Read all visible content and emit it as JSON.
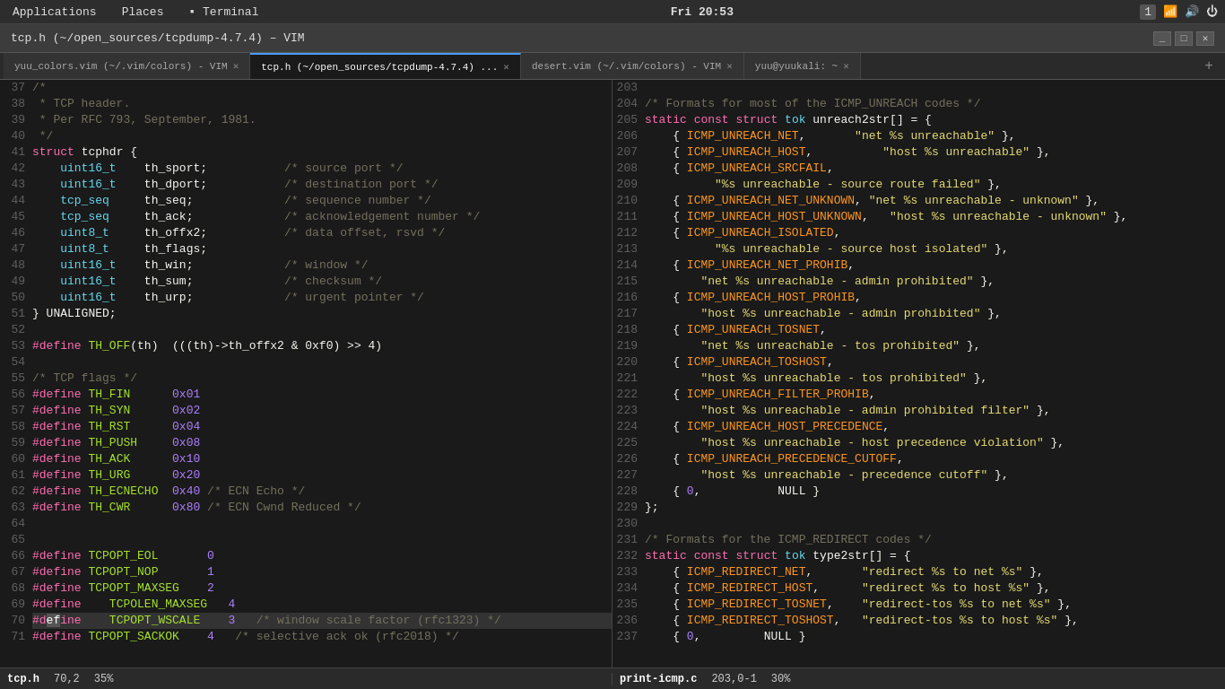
{
  "system_bar": {
    "apps_label": "Applications",
    "places_label": "Places",
    "terminal_label": "Terminal",
    "time": "Fri 20:53",
    "workspace_num": "1"
  },
  "window": {
    "title": "tcp.h (~/open_sources/tcpdump-4.7.4) – VIM"
  },
  "tabs": [
    {
      "id": "tab1",
      "label": "yuu_colors.vim (~/.vim/colors) - VIM",
      "active": false
    },
    {
      "id": "tab2",
      "label": "tcp.h (~/open_sources/tcpdump-4.7.4) ...",
      "active": true
    },
    {
      "id": "tab3",
      "label": "desert.vim (~/.vim/colors) - VIM",
      "active": false
    },
    {
      "id": "tab4",
      "label": "yuu@yuukali: ~",
      "active": false
    }
  ],
  "status_bar": {
    "left": {
      "filename": "tcp.h",
      "position": "70,2",
      "percent": "35%"
    },
    "right": {
      "filename": "print-icmp.c",
      "position": "203,0-1",
      "percent": "30%"
    }
  }
}
